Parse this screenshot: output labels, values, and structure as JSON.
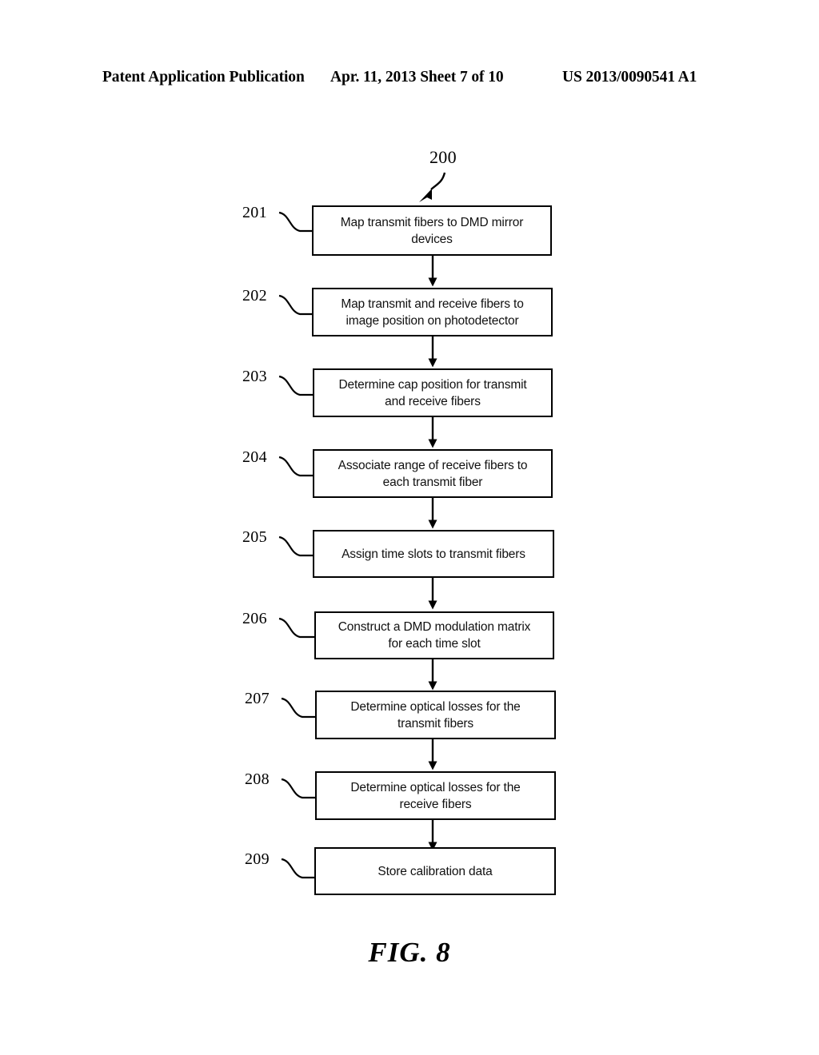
{
  "header": {
    "left": "Patent Application Publication",
    "center": "Apr. 11, 2013  Sheet 7 of 10",
    "right": "US 2013/0090541 A1"
  },
  "figure": {
    "caption": "FIG. 8",
    "diagram_ref": "200",
    "steps": [
      {
        "ref": "201",
        "text": "Map transmit fibers to DMD mirror\ndevices"
      },
      {
        "ref": "202",
        "text": "Map transmit and receive fibers to\nimage position on photodetector"
      },
      {
        "ref": "203",
        "text": "Determine cap position for transmit\nand receive fibers"
      },
      {
        "ref": "204",
        "text": "Associate range of receive fibers to\neach transmit fiber"
      },
      {
        "ref": "205",
        "text": "Assign time slots to transmit fibers"
      },
      {
        "ref": "206",
        "text": "Construct a DMD modulation matrix\nfor each time slot"
      },
      {
        "ref": "207",
        "text": "Determine optical losses for the\ntransmit fibers"
      },
      {
        "ref": "208",
        "text": "Determine optical losses for the\nreceive fibers"
      },
      {
        "ref": "209",
        "text": "Store calibration data"
      }
    ]
  }
}
